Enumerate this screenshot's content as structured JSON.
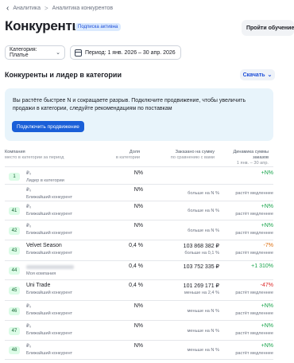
{
  "breadcrumb": {
    "back_icon": "arrow-left-icon",
    "items": [
      "Аналитика",
      "Аналитика конкурентов"
    ],
    "separator": ">"
  },
  "header": {
    "title": "Конкуренты",
    "badge": "Подписка активна",
    "help_button": "Пройти обучение"
  },
  "filters": {
    "category": "Категория: Платье",
    "period": "Период: 1 янв. 2026 – 30 апр. 2026"
  },
  "section": {
    "title": "Конкуренты и лидер в категории",
    "sort_label": "Скачать"
  },
  "banner": {
    "text": "Вы растёте быстрее N и сокращаете разрыв. Подключите продвижение, чтобы увеличить продажи в категории, следуйте рекомендациям по поставкам",
    "button": "Подключить продвижение"
  },
  "table": {
    "headers": {
      "company": "Компания",
      "company_sub": "место в категории за период",
      "share": "Доля",
      "share_sub": "в категории",
      "ordered": "Заказано на сумму",
      "ordered_sub": "по сравнению с вами",
      "dynamics": "Динамика суммы заказов",
      "dynamics_sub": "1 янв. – 30 апр."
    },
    "rows": [
      {
        "rank": "1",
        "icon": "₽₀",
        "role": "Лидер в категории",
        "share": "N%",
        "amount": "",
        "note": "",
        "dyn": "+N%",
        "dyn_note": ""
      },
      {
        "rank": "",
        "icon": "₽₀",
        "role": "Ближайший конкурент",
        "share": "N%",
        "amount": "",
        "note": "больше на N %",
        "dyn": "",
        "dyn_note": "растёт медленнее"
      },
      {
        "rank": "41",
        "icon": "₽₀",
        "role": "Ближайший конкурент",
        "share": "N%",
        "amount": "",
        "note": "больше на N %",
        "dyn": "+N%",
        "dyn_note": "растёт медленнее"
      },
      {
        "rank": "42",
        "icon": "₽₀",
        "role": "Ближайший конкурент",
        "share": "N%",
        "amount": "",
        "note": "больше на N %",
        "dyn": "+N%",
        "dyn_note": "растёт медленнее"
      },
      {
        "rank": "43",
        "name": "Velvet Season",
        "role": "Ближайший конкурент",
        "share": "0,4 %",
        "amount": "103 868 382 ₽",
        "note": "больше на 0,1 %",
        "dyn": "-7%",
        "dyn_note": "растёт медленнее"
      },
      {
        "rank": "44",
        "role": "Моя компания",
        "share": "0,4 %",
        "amount": "103 752 335 ₽",
        "note": "",
        "dyn": "+1 310%",
        "dyn_note": ""
      },
      {
        "rank": "45",
        "name": "Uni Trade",
        "role": "Ближайший конкурент",
        "share": "0,4 %",
        "amount": "101 269 171 ₽",
        "note": "меньше на 2,4 %",
        "dyn": "-47%",
        "dyn_note": "растёт медленнее"
      },
      {
        "rank": "46",
        "icon": "₽₀",
        "role": "Ближайший конкурент",
        "share": "N%",
        "amount": "",
        "note": "меньше на N %",
        "dyn": "+N%",
        "dyn_note": "растёт медленнее"
      },
      {
        "rank": "47",
        "icon": "₽₀",
        "role": "Ближайший конкурент",
        "share": "N%",
        "amount": "",
        "note": "меньше на N %",
        "dyn": "+N%",
        "dyn_note": "растёт медленнее"
      },
      {
        "rank": "48",
        "icon": "₽₀",
        "role": "Ближайший конкурент",
        "share": "N%",
        "amount": "",
        "note": "меньше на N %",
        "dyn": "+N%",
        "dyn_note": "растёт медленнее"
      }
    ]
  }
}
